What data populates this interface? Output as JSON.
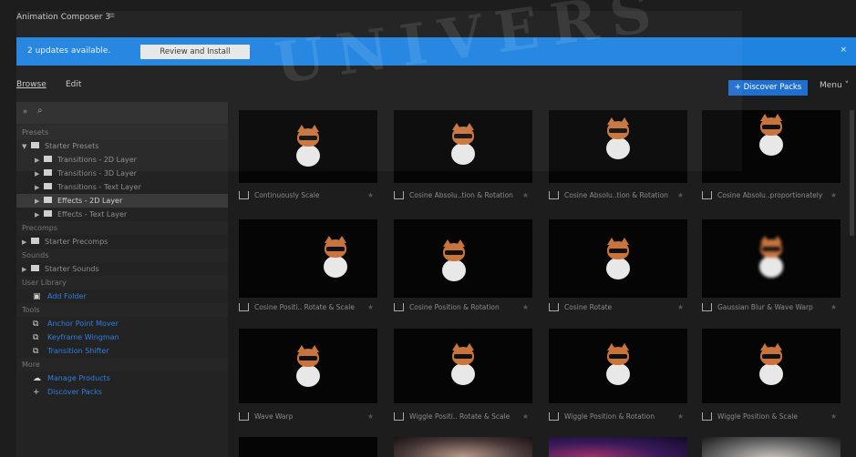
{
  "app": {
    "title": "Animation Composer 3",
    "menu_glyph": "≡"
  },
  "banner": {
    "message": "2 updates available.",
    "button": "Review and Install",
    "close": "×"
  },
  "tabs": [
    {
      "label": "Browse"
    },
    {
      "label": "Edit"
    }
  ],
  "header": {
    "discover_button": "+ Discover Packs",
    "menu_label": "Menu ˅"
  },
  "search": {
    "placeholder": "",
    "star": "★",
    "icon": "⌕"
  },
  "sidebar": {
    "presets_heading": "Presets",
    "starter_presets": "Starter Presets",
    "presets": [
      "Transitions - 2D Layer",
      "Transitions - 3D Layer",
      "Transitions - Text Layer",
      "Effects - 2D Layer",
      "Effects - Text Layer"
    ],
    "precomps_heading": "Precomps",
    "starter_precomps": "Starter Precomps",
    "sounds_heading": "Sounds",
    "starter_sounds": "Starter Sounds",
    "user_library_heading": "User Library",
    "add_folder": "Add Folder",
    "tools_heading": "Tools",
    "tools": [
      "Anchor Point Mover",
      "Keyframe Wingman",
      "Transition Shifter"
    ],
    "more_heading": "More",
    "more": [
      "Manage Products",
      "Discover Packs"
    ]
  },
  "grid": {
    "items": [
      "Continuously Scale",
      "Cosine Absolu..tion & Rotation",
      "Cosine Absolu..tion & Rotation",
      "Cosine Absolu..proportionately",
      "Cosine Positi.. Rotate & Scale",
      "Cosine Position & Rotation",
      "Cosine Rotate",
      "Gaussian Blur & Wave Warp",
      "Wave Warp",
      "Wiggle Positi.. Rotate & Scale",
      "Wiggle Position & Rotation",
      "Wiggle Position & Scale"
    ]
  },
  "watermark": {
    "text": "UNIVERS"
  },
  "colors": {
    "accent": "#1f83e0",
    "discover": "#1f6fd1",
    "link": "#2f7fe0"
  }
}
